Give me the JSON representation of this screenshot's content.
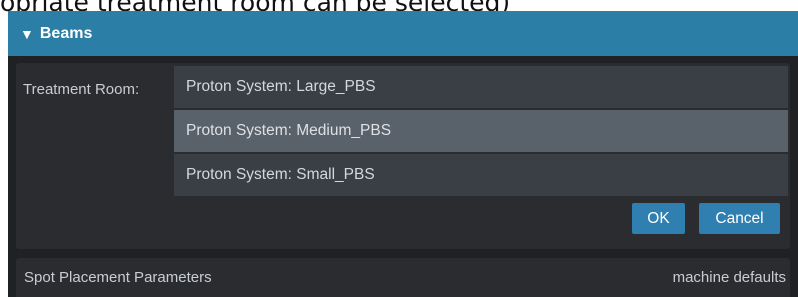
{
  "caption": "opriate treatment room can be selected)",
  "beams_panel": {
    "title": "Beams",
    "treatment_room_label": "Treatment Room:",
    "options": [
      {
        "label": "Proton System: Large_PBS",
        "selected": false
      },
      {
        "label": "Proton System: Medium_PBS",
        "selected": true
      },
      {
        "label": "Proton System: Small_PBS",
        "selected": false
      }
    ],
    "ok_label": "OK",
    "cancel_label": "Cancel"
  },
  "spot_placement": {
    "label": "Spot Placement Parameters",
    "value": "machine defaults"
  },
  "colors": {
    "header": "#2b7fa6",
    "panel_bg": "#1f2124",
    "option_bg": "#3a3f46",
    "option_selected_bg": "#59616a",
    "button_bg": "#2f7fb0"
  },
  "icons": {
    "collapse": "triangle-down-icon"
  }
}
